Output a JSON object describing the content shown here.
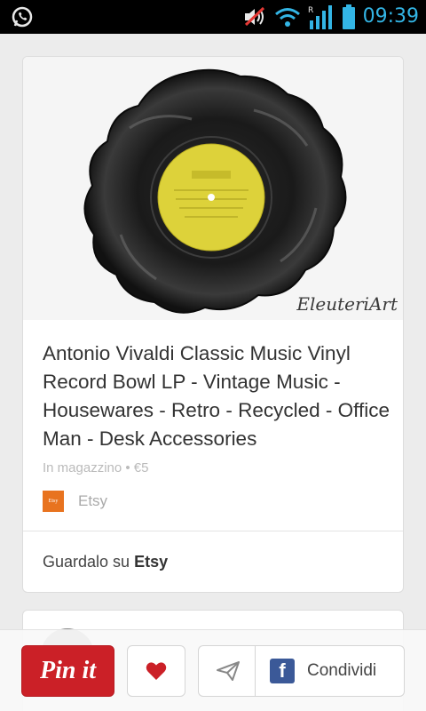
{
  "status_bar": {
    "time": "09:39",
    "icons": [
      "whatsapp-icon",
      "mute-icon",
      "wifi-icon",
      "signal-icon",
      "battery-icon"
    ],
    "accent_color": "#33b5e5"
  },
  "pin": {
    "watermark": "EleuteriArt",
    "title": "Antonio Vivaldi Classic Music Vinyl Record Bowl LP - Vintage Music - Housewares - Retro - Recycled - Office Man - Desk Accessories",
    "meta": "In magazzino • €5",
    "source_logo_text": "Etsy",
    "source_name": "Etsy",
    "view_on_prefix": "Guardalo su",
    "view_on_site": "Etsy",
    "image_icon": "vinyl-record-bowl-image"
  },
  "actions": {
    "pin_label": "Pin it",
    "like_icon": "heart-icon",
    "send_icon": "send-icon",
    "share_icon": "facebook-icon",
    "share_label": "Condividi",
    "pin_color": "#cb2027",
    "like_color": "#cb2027",
    "facebook_color": "#3b5998"
  }
}
